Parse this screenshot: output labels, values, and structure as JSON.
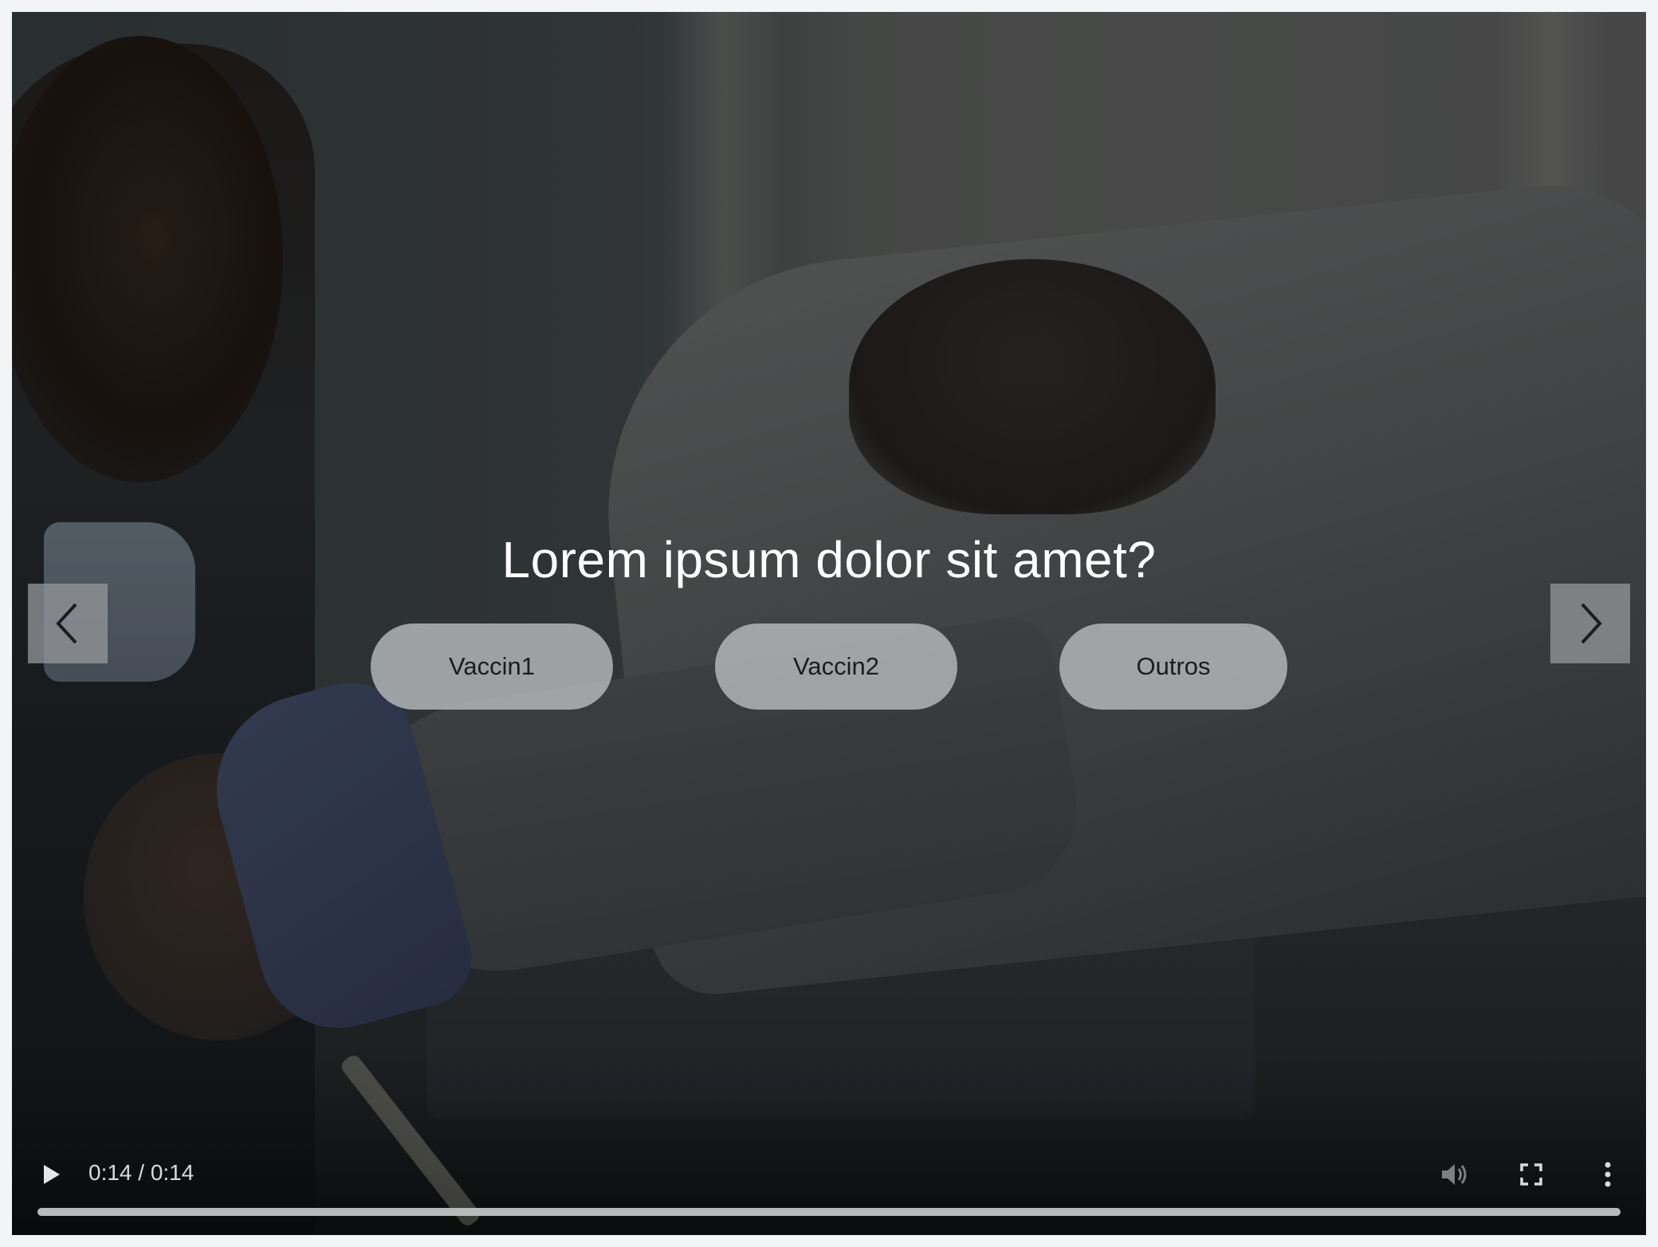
{
  "question": {
    "text": "Lorem ipsum dolor sit amet?"
  },
  "choices": [
    {
      "label": "Vaccin1"
    },
    {
      "label": "Vaccin2"
    },
    {
      "label": "Outros"
    }
  ],
  "navigation": {
    "prev_icon": "chevron-left-icon",
    "next_icon": "chevron-right-icon"
  },
  "video": {
    "time_display": "0:14 / 0:14",
    "progress_fraction": 1.0,
    "play_icon": "play-icon",
    "volume_icon": "volume-icon",
    "fullscreen_icon": "fullscreen-icon",
    "more_icon": "more-vertical-icon"
  },
  "colors": {
    "choice_bg": "#bec0c4",
    "text_light": "#ffffff",
    "progress_fill": "#b9babb"
  }
}
